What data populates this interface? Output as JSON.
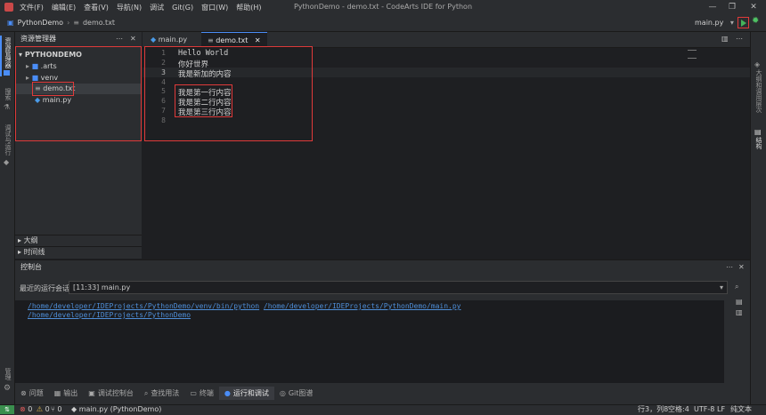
{
  "menu": [
    "文件(F)",
    "编辑(E)",
    "查看(V)",
    "导航(N)",
    "调试",
    "Git(G)",
    "窗口(W)",
    "帮助(H)"
  ],
  "window_title": "PythonDemo - demo.txt - CodeArts IDE for Python",
  "breadcrumb": {
    "project": "PythonDemo",
    "sep": "›",
    "file": "demo.txt"
  },
  "run_config": "main.py",
  "left_activity": {
    "explorer": "资源管理器",
    "search": "搜索",
    "debug": "调试与运行",
    "settings": "管理"
  },
  "right_activity": {
    "outline": "大纲和调用层次",
    "structure": "结构"
  },
  "structure_tooltip": "结构",
  "explorer": {
    "title": "资源管理器",
    "root": "PYTHONDEMO",
    "items": [
      {
        "name": ".arts",
        "type": "folder"
      },
      {
        "name": "venv",
        "type": "folder"
      },
      {
        "name": "demo.txt",
        "type": "text-file"
      },
      {
        "name": "main.py",
        "type": "python-file"
      }
    ],
    "sections": [
      "大纲",
      "时间线"
    ]
  },
  "tabs": [
    {
      "label": "main.py",
      "active": false
    },
    {
      "label": "demo.txt",
      "active": true
    }
  ],
  "editor_lines": [
    {
      "num": "1",
      "text": "Hello World"
    },
    {
      "num": "2",
      "text": "你好世界"
    },
    {
      "num": "3",
      "text": "我是新加的内容"
    },
    {
      "num": "4",
      "text": ""
    },
    {
      "num": "5",
      "text": "我是第一行内容"
    },
    {
      "num": "6",
      "text": "我是第二行内容"
    },
    {
      "num": "7",
      "text": "我是第三行内容"
    },
    {
      "num": "8",
      "text": ""
    }
  ],
  "console": {
    "title": "控制台",
    "session_label": "最近的运行会话",
    "session_value": "[11:33] main.py",
    "output": [
      {
        "a": "/home/developer/IDEProjects/PythonDemo/venv/bin/python",
        "b": "/home/developer/IDEProjects/PythonDemo/main.py"
      },
      {
        "a": "/home/developer/IDEProjects/PythonDemo",
        "b": ""
      }
    ]
  },
  "bottom_tabs": [
    {
      "label": "问题",
      "icon": "problems-icon",
      "active": false
    },
    {
      "label": "输出",
      "icon": "output-icon",
      "active": false
    },
    {
      "label": "调试控制台",
      "icon": "debug-console-icon",
      "active": false
    },
    {
      "label": "查找用法",
      "icon": "find-usages-icon",
      "active": false
    },
    {
      "label": "终端",
      "icon": "terminal-icon",
      "active": false
    },
    {
      "label": "运行和调试",
      "icon": "run-debug-icon",
      "active": true
    },
    {
      "label": "Git图谱",
      "icon": "git-graph-icon",
      "active": false
    }
  ],
  "status": {
    "errors": "0",
    "warnings": "0",
    "git": "0",
    "interpreter": "main.py (PythonDemo)",
    "position": "行3，列8",
    "indent": "空格:4",
    "encoding": "UTF-8",
    "eol": "LF",
    "language": "纯文本"
  },
  "colors": {
    "accent": "#4a8df7",
    "highlight_box": "#e03a3a",
    "run_green": "#45b35a"
  }
}
